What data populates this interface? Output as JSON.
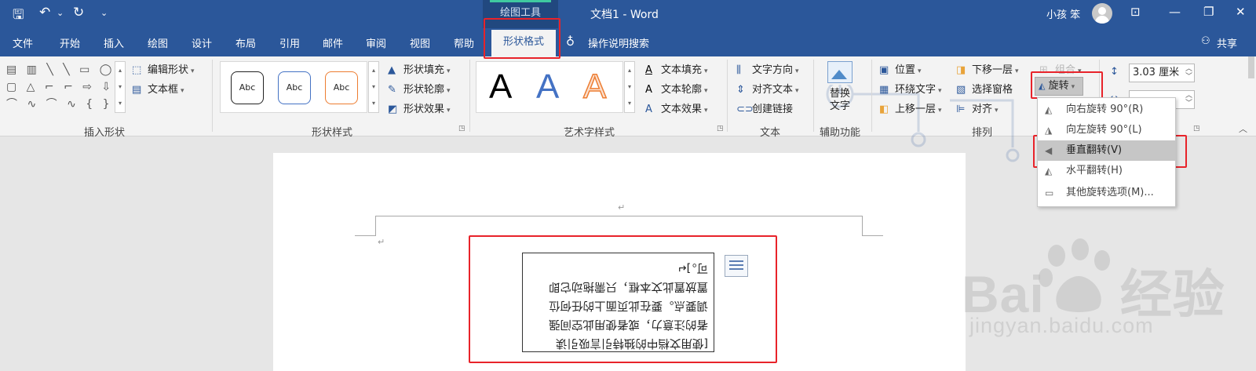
{
  "titlebar": {
    "context_group": "绘图工具",
    "doc_title": "文档1 - Word",
    "user": "小孩 笨",
    "quick_access": {
      "save": "🖫",
      "undo": "↶",
      "undo_dd": "⌄",
      "redo": "↻",
      "customize": "⌄"
    },
    "window": {
      "ribbon_opts": "⊡",
      "minimize": "—",
      "restore": "❐",
      "close": "✕"
    }
  },
  "tabs": [
    "文件",
    "开始",
    "插入",
    "绘图",
    "设计",
    "布局",
    "引用",
    "邮件",
    "审阅",
    "视图",
    "帮助"
  ],
  "active_tab": "形状格式",
  "tell_me": "操作说明搜索",
  "share": "共享",
  "ribbon": {
    "insert_shapes": {
      "label": "插入形状",
      "gallery_rows": [
        "▤ ▥ ╲ ╲ ▭ ◯",
        "▢ △ ⌐ ⌐ ⇨ ⇩",
        "⌒ ∿ ⌒ ∿ { }"
      ],
      "edit_shape": "编辑形状",
      "text_box": "文本框"
    },
    "shape_styles": {
      "label": "形状样式",
      "samples": [
        "Abc",
        "Abc",
        "Abc"
      ],
      "fill": "形状填充",
      "outline": "形状轮廓",
      "effects": "形状效果"
    },
    "wordart": {
      "label": "艺术字样式",
      "samples": [
        "A",
        "A",
        "A"
      ],
      "text_fill": "文本填充",
      "text_outline": "文本轮廓",
      "text_effects": "文本效果"
    },
    "text": {
      "label": "文本",
      "direction": "文字方向",
      "align": "对齐文本",
      "link": "创建链接"
    },
    "accessibility": {
      "label": "辅助功能",
      "alt_text_1": "替换",
      "alt_text_2": "文字"
    },
    "arrange": {
      "label": "排列",
      "position": "位置",
      "wrap": "环绕文字",
      "forward": "上移一层",
      "backward": "下移一层",
      "pane": "选择窗格",
      "align": "对齐",
      "group": "组合",
      "rotate": "旋转"
    },
    "size": {
      "height": "3.03 厘米"
    }
  },
  "rotate_menu": [
    {
      "label": "向右旋转 90°(R)",
      "icon": "rotate-right-icon"
    },
    {
      "label": "向左旋转 90°(L)",
      "icon": "rotate-left-icon"
    },
    {
      "label": "垂直翻转(V)",
      "icon": "flip-vertical-icon",
      "highlighted": true
    },
    {
      "label": "水平翻转(H)",
      "icon": "flip-horizontal-icon"
    },
    {
      "label": "其他旋转选项(M)...",
      "icon": "more-rotation-icon"
    }
  ],
  "document": {
    "textbox_lines": [
      "[使用文档中的独特引言吸引读",
      "者的注意力，或者使用此空间强",
      "调要点。要在此页面上的任何位",
      "置放置此文本框，只需拖动它即",
      "可。]↵"
    ],
    "para_mark": "↵"
  },
  "watermark": {
    "brand": "Bai",
    "brand_suffix": "经验",
    "url": "jingyan.baidu.com"
  },
  "colors": {
    "word_blue": "#2b579a",
    "highlight_red": "#e8232a",
    "menu_highlight": "#c6c6c6"
  }
}
